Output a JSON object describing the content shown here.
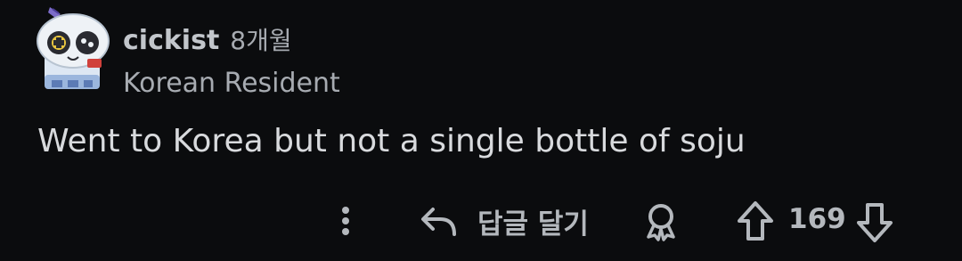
{
  "comment": {
    "author": "cickist",
    "timestamp": "8개월",
    "flair": "Korean Resident",
    "body": "Went to Korea but not a single bottle of soju"
  },
  "actions": {
    "more_icon": "more-vertical-icon",
    "reply_icon": "reply-arrow-icon",
    "reply_label": "답글 달기",
    "award_icon": "award-icon",
    "upvote_icon": "upvote-arrow-icon",
    "score": "169",
    "downvote_icon": "downvote-arrow-icon"
  },
  "colors": {
    "background": "#0b0c0e",
    "text": "#d8dadd",
    "muted": "#a7abb1"
  }
}
